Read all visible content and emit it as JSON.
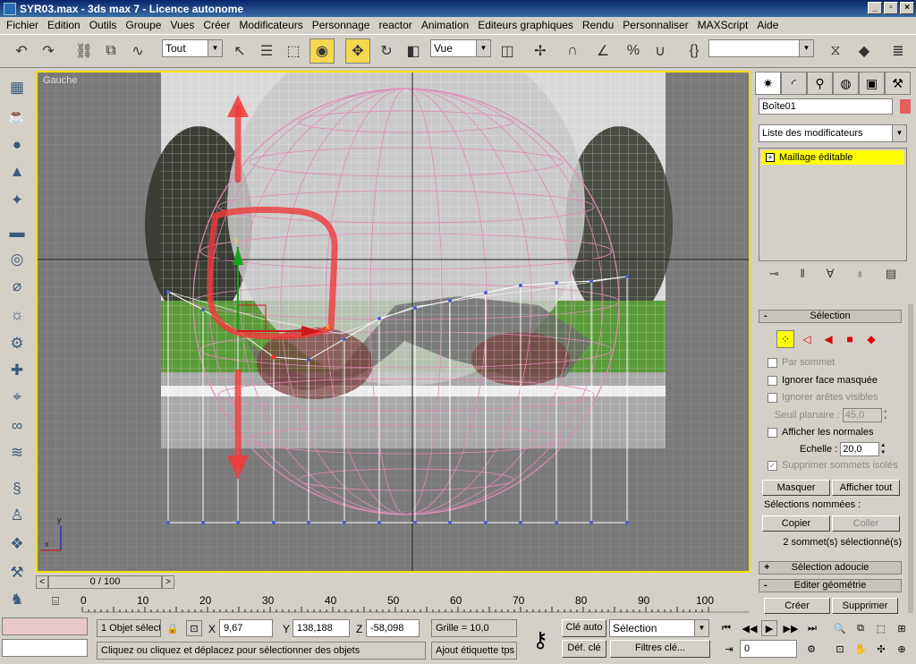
{
  "window": {
    "title": "SYR03.max - 3ds max 7 - Licence autonome"
  },
  "menu": [
    "Fichier",
    "Edition",
    "Outils",
    "Groupe",
    "Vues",
    "Créer",
    "Modificateurs",
    "Personnage",
    "reactor",
    "Animation",
    "Editeurs graphiques",
    "Rendu",
    "Personnaliser",
    "MAXScript",
    "Aide"
  ],
  "toolbar": {
    "selection_filter": "Tout",
    "ref_coord": "Vue"
  },
  "viewport": {
    "label": "Gauche",
    "gizmo_x_label": "x",
    "gizmo_y_label": "y",
    "corner_x_label": "x",
    "corner_y_label": "y"
  },
  "command_panel": {
    "object_name": "Boîte01",
    "object_color": "#e06060",
    "modifier_list": "Liste des modificateurs",
    "stack_item": "Maillage éditable",
    "rollouts": {
      "selection": {
        "title": "Sélection",
        "by_vertex": "Par sommet",
        "ignore_backfacing": "Ignorer face masquée",
        "ignore_visible_edges": "Ignorer arêtes visibles",
        "planar_threshold_label": "Seuil planaire :",
        "planar_threshold_value": "45,0",
        "show_normals": "Afficher les normales",
        "scale_label": "Echelle :",
        "scale_value": "20,0",
        "delete_isolated": "Supprimer sommets isolés",
        "hide_btn": "Masquer",
        "unhide_all_btn": "Afficher tout",
        "named_selections": "Sélections nommées :",
        "copy_btn": "Copier",
        "paste_btn": "Coller",
        "status": "2 sommet(s) sélectionné(s)"
      },
      "soft_selection": "Sélection adoucie",
      "edit_geometry": "Editer géométrie",
      "create_btn": "Créer",
      "delete_btn": "Supprimer"
    }
  },
  "timeline": {
    "frame": "0 / 100",
    "ticks": [
      "0",
      "10",
      "20",
      "30",
      "40",
      "50",
      "60",
      "70",
      "80",
      "90",
      "100"
    ]
  },
  "statusbar": {
    "selected": "1 Objet sélect",
    "x_label": "X",
    "x": "9,67",
    "y_label": "Y",
    "y": "138,188",
    "z_label": "Z",
    "z": "-58,098",
    "grid": "Grille = 10,0",
    "prompt": "Cliquez ou cliquez et déplacez pour sélectionner des objets",
    "add_tag": "Ajout étiquette tps",
    "auto_key": "Clé auto",
    "set_key": "Déf. clé",
    "key_mode": "Sélection",
    "key_filters": "Filtres clé...",
    "frame_field": "0"
  },
  "colors": {
    "viewport_border": "#f0e000",
    "selection_yellow": "#ffff00"
  }
}
